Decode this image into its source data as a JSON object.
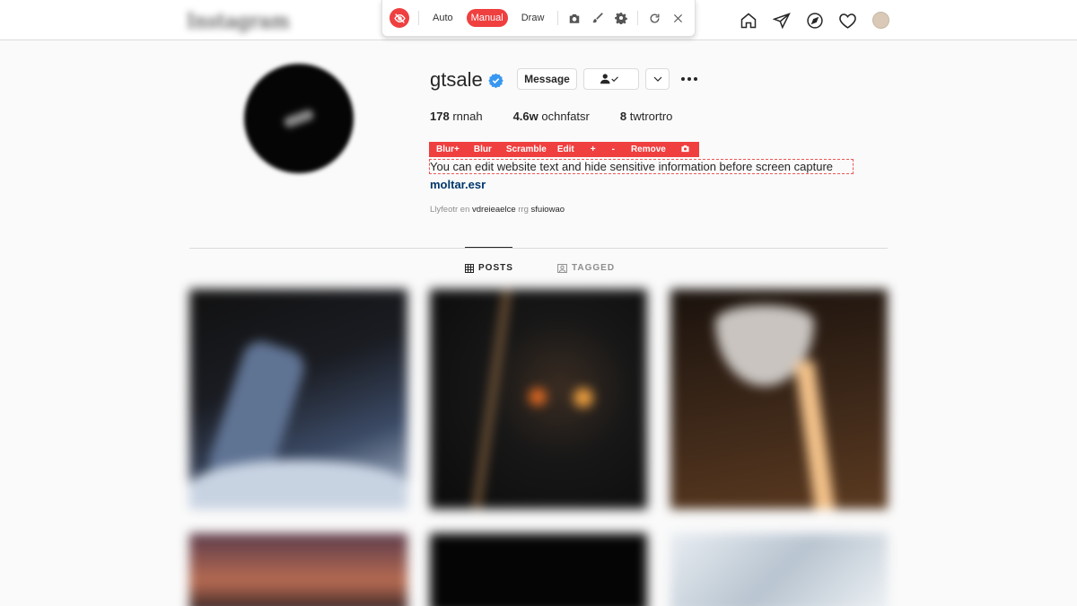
{
  "nav": {
    "logo_text": "Instagram",
    "icons": [
      "home-icon",
      "direct-icon",
      "explore-icon",
      "heart-icon",
      "avatar"
    ]
  },
  "extension_toolbar": {
    "modes": [
      "Auto",
      "Manual",
      "Draw"
    ],
    "active_mode": "Manual",
    "icons": [
      "eye-off-icon",
      "camera-icon",
      "brush-icon",
      "gear-icon",
      "refresh-icon",
      "close-icon"
    ],
    "accent_color": "#ef3f3f"
  },
  "profile": {
    "username": "gtsale",
    "verified": true,
    "message_label": "Message",
    "stats": [
      {
        "value": "178",
        "label": "rnnah"
      },
      {
        "value": "4.6w",
        "label": "ochnfatsr"
      },
      {
        "value": "8",
        "label": "twtrortro"
      }
    ],
    "edit_toolbar": [
      "Blur+",
      "Blur",
      "Scramble",
      "Edit",
      "+",
      "-",
      "Remove"
    ],
    "bio": "You can edit website text and hide sensitive information before screen capture",
    "link": "moltar.esr",
    "followed_by_prefix": "Llyfeotr en",
    "followed_by_name1": "vdreieaelce",
    "followed_by_mid": "rrg",
    "followed_by_name2": "sfuiowao"
  },
  "tabs": [
    {
      "label": "POSTS",
      "active": true
    },
    {
      "label": "TAGGED",
      "active": false
    }
  ]
}
